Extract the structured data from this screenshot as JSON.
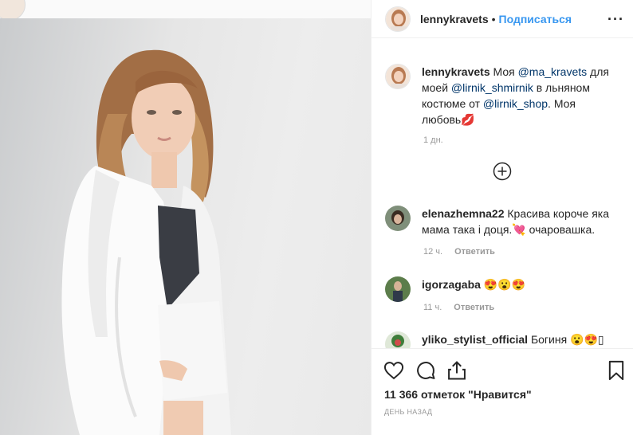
{
  "post": {
    "username": "lennykravets",
    "separator": "•",
    "follow_label": "Подписаться",
    "more_label": "···"
  },
  "caption": {
    "username": "lennykravets",
    "text_1": "Моя ",
    "mention_1": "@ma_kravets",
    "text_2": " для моей ",
    "mention_2": "@lirnik_shmirnik",
    "text_3": " в льняном костюме от ",
    "mention_3": "@lirnik_shop",
    "text_4": ". Моя любовь💋",
    "time": "1 дн."
  },
  "comments": [
    {
      "username": "elenazhemna22",
      "text": "Красива короче яка мама така і доця.💘 очаровашка.",
      "time": "12 ч.",
      "reply": "Ответить"
    },
    {
      "username": "igorzagaba",
      "text": "😍😮😍",
      "time": "11 ч.",
      "reply": "Ответить"
    },
    {
      "username": "yliko_stylist_official",
      "text": "Богиня 😮😍▯"
    }
  ],
  "footer": {
    "likes": "11 366 отметок \"Нравится\"",
    "date": "ДЕНЬ НАЗАД"
  },
  "icons": [
    "heart-icon",
    "comment-icon",
    "share-icon",
    "bookmark-icon",
    "more-options-icon",
    "add-comment-icon"
  ],
  "colors": {
    "link": "#3897f0",
    "mention": "#003569",
    "meta": "#999999",
    "border": "#efefef"
  }
}
